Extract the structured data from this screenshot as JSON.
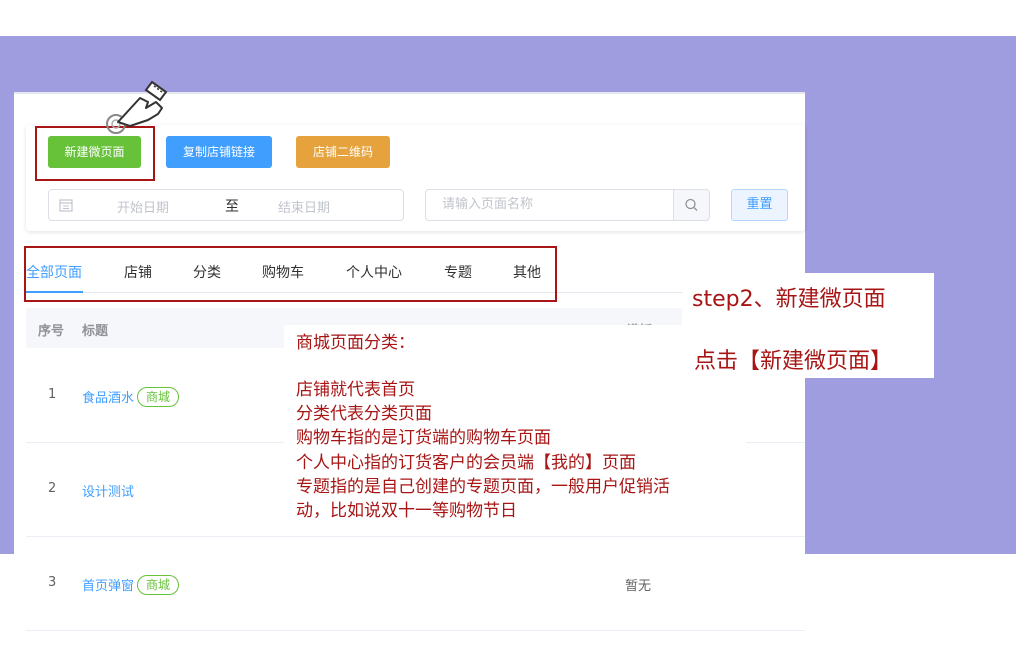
{
  "toolbar": {
    "new_page": "新建微页面",
    "copy_link": "复制店铺链接",
    "qr_code": "店铺二维码"
  },
  "filters": {
    "start_date": "开始日期",
    "to": "至",
    "end_date": "结束日期",
    "search_placeholder": "请输入页面名称",
    "reset": "重置"
  },
  "tabs": [
    {
      "label": "全部页面",
      "active": true
    },
    {
      "label": "店铺"
    },
    {
      "label": "分类"
    },
    {
      "label": "购物车"
    },
    {
      "label": "个人中心"
    },
    {
      "label": "专题"
    },
    {
      "label": "其他"
    }
  ],
  "table": {
    "headers": {
      "index": "序号",
      "title": "标题",
      "template": "模板"
    },
    "rows": [
      {
        "index": "1",
        "title": "食品酒水",
        "tag": "商城",
        "template": ""
      },
      {
        "index": "2",
        "title": "设计测试",
        "tag": "",
        "template": ""
      },
      {
        "index": "3",
        "title": "首页弹窗",
        "tag": "商城",
        "template": "暂无"
      }
    ]
  },
  "annotation": {
    "step_title": "step2、新建微页面",
    "step_sub": "点击【新建微页面】",
    "note_lines": [
      "商城页面分类：",
      "",
      "店铺就代表首页",
      "分类代表分类页面",
      "购物车指的是订货端的购物车页面",
      "个人中心指的订货客户的会员端【我的】页面",
      "专题指的是自己创建的专题页面，一般用户促销活",
      "动，比如说双十一等购物节日"
    ]
  },
  "colors": {
    "purple_bg": "#9f9cdf",
    "green": "#67c23a",
    "blue": "#409eff",
    "orange": "#e6a23c",
    "annotation_red": "#a81515"
  },
  "icons": [
    "hand-pointer-icon",
    "calendar-icon",
    "search-icon"
  ]
}
